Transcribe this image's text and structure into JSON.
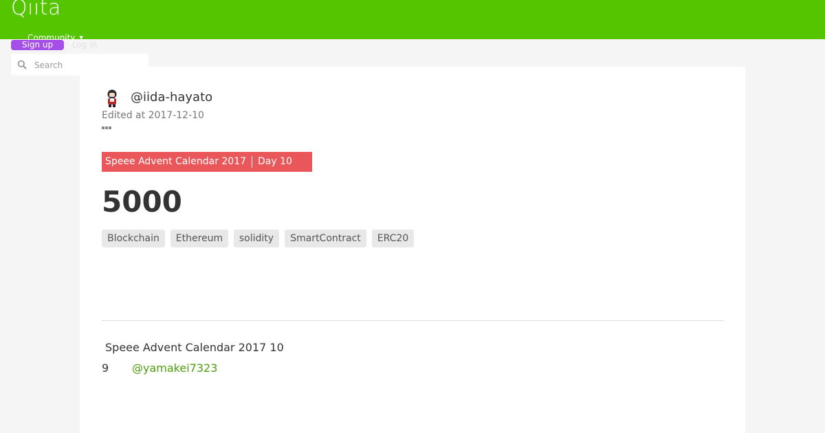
{
  "header": {
    "logo": "Qiita",
    "community_label": "Community",
    "signup_label": "Sign up",
    "login_label": "Log in",
    "search": {
      "placeholder": "Search"
    },
    "brand_color": "#55c500",
    "signup_color": "#a54fe8"
  },
  "article": {
    "author": "@iida-hayato",
    "edited": "Edited at 2017-12-10",
    "calendar": {
      "name": "Speee Advent Calendar 2017",
      "day": "Day 10",
      "color": "#e9575a"
    },
    "title": "5000",
    "tags": [
      "Blockchain",
      "Ethereum",
      "solidity",
      "SmartContract",
      "ERC20"
    ]
  },
  "footer_calendar": {
    "heading": "Speee Advent Calendar 2017 10",
    "prev_day": "9",
    "prev_user": "@yamakei7323",
    "link_color": "#4b9e0a"
  },
  "icons": {
    "search": "search-icon",
    "caret": "chevron-down-icon",
    "more": "more-dots-icon",
    "avatar": "avatar"
  }
}
